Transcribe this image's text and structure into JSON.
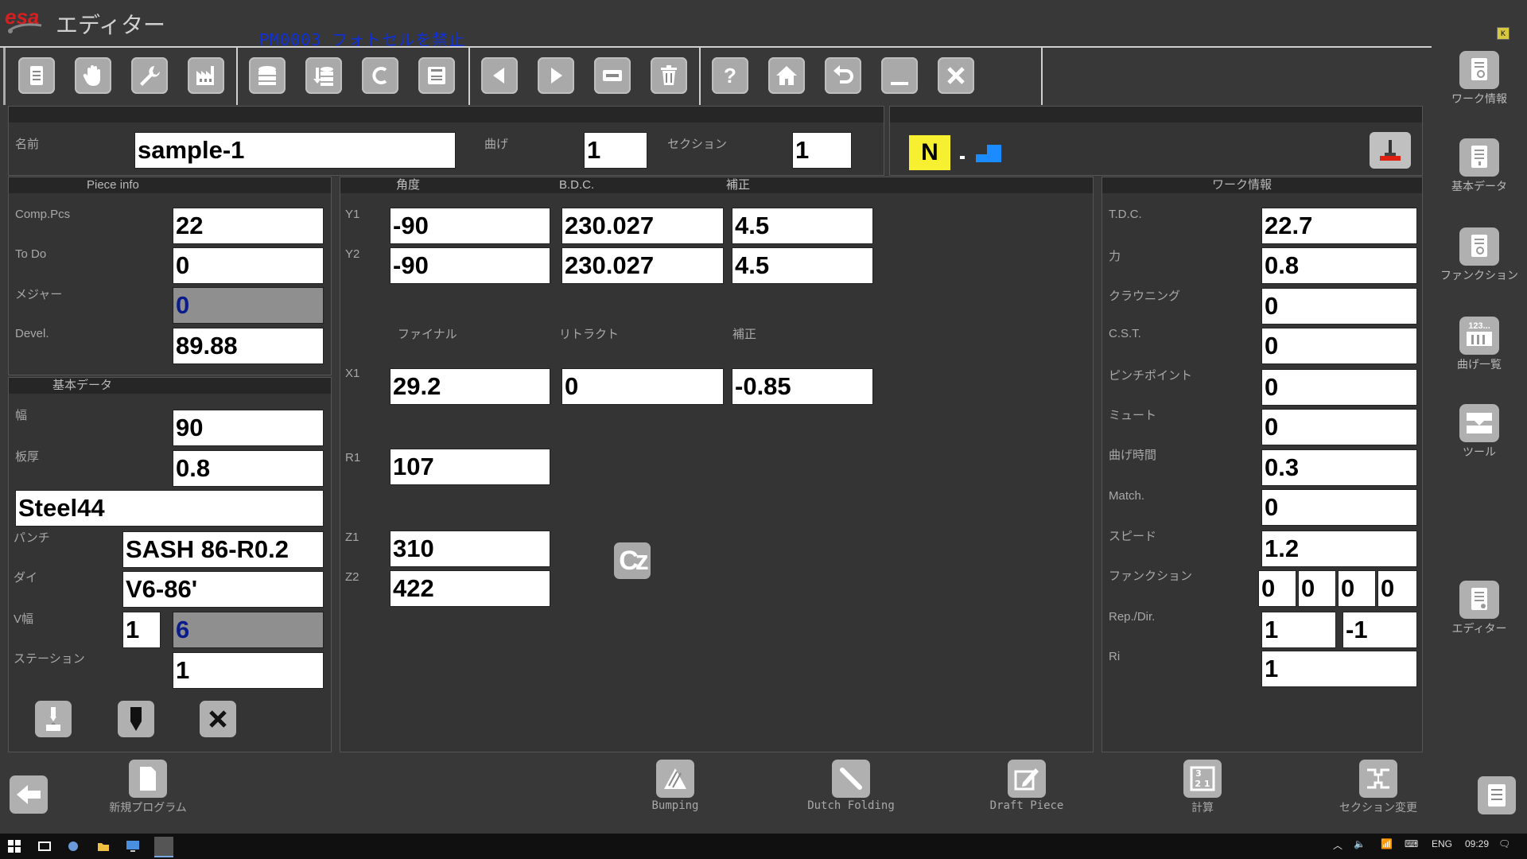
{
  "app": {
    "logo_text": "esa",
    "title": "エディター",
    "message": "PM0003 フォトセルを禁止"
  },
  "toolbar": {
    "buttons": [
      {
        "name": "file-icon"
      },
      {
        "name": "hand-icon"
      },
      {
        "name": "wrench-icon"
      },
      {
        "name": "factory-icon"
      },
      {
        "name": "database-icon"
      },
      {
        "name": "database-down-icon"
      },
      {
        "name": "c-icon"
      },
      {
        "name": "save-icon"
      },
      {
        "name": "prev-icon"
      },
      {
        "name": "next-icon"
      },
      {
        "name": "minus-icon"
      },
      {
        "name": "trash-icon"
      },
      {
        "name": "help-icon"
      },
      {
        "name": "home-icon"
      },
      {
        "name": "undo-icon"
      },
      {
        "name": "minimize-icon"
      },
      {
        "name": "close-icon"
      }
    ]
  },
  "header": {
    "name_label": "名前",
    "name_value": "sample-1",
    "bend_label": "曲げ",
    "bend_value": "1",
    "section_label": "セクション",
    "section_value": "1",
    "mode_badge": "N"
  },
  "piece_info": {
    "title": "Piece info",
    "rows": [
      {
        "label": "Comp.Pcs",
        "value": "22"
      },
      {
        "label": "To Do",
        "value": "0"
      },
      {
        "label": "メジャー",
        "value": "0"
      },
      {
        "label": "Devel.",
        "value": "89.88"
      }
    ]
  },
  "basic_data": {
    "title": "基本データ",
    "width_label": "幅",
    "width_value": "90",
    "thickness_label": "板厚",
    "thickness_value": "0.8",
    "material": "Steel44",
    "punch_label": "パンチ",
    "punch_value": "SASH 86-R0.2",
    "die_label": "ダイ",
    "die_value": "V6-86'",
    "v_label": "V幅",
    "v_value1": "1",
    "v_value2": "6",
    "station_label": "ステーション",
    "station_value": "1"
  },
  "center": {
    "headers": [
      "角度",
      "B.D.C.",
      "補正"
    ],
    "y1": {
      "label": "Y1",
      "values": [
        "-90",
        "230.027",
        "4.5"
      ]
    },
    "y2": {
      "label": "Y2",
      "values": [
        "-90",
        "230.027",
        "4.5"
      ]
    },
    "x_headers": [
      "ファイナル",
      "リトラクト",
      "補正"
    ],
    "x1": {
      "label": "X1",
      "values": [
        "29.2",
        "0",
        "-0.85"
      ]
    },
    "r1": {
      "label": "R1",
      "value": "107"
    },
    "z1": {
      "label": "Z1",
      "value": "310"
    },
    "z2": {
      "label": "Z2",
      "value": "422"
    },
    "cz_label": "Cz"
  },
  "work_info": {
    "title": "ワーク情報",
    "rows": [
      {
        "label": "T.D.C.",
        "value": "22.7"
      },
      {
        "label": "力",
        "value": "0.8"
      },
      {
        "label": "クラウニング",
        "value": "0"
      },
      {
        "label": "C.S.T.",
        "value": "0"
      },
      {
        "label": "ピンチポイント",
        "value": "0"
      },
      {
        "label": "ミュート",
        "value": "0"
      },
      {
        "label": "曲げ時間",
        "value": "0.3"
      },
      {
        "label": "Match.",
        "value": "0"
      },
      {
        "label": "スピード",
        "value": "1.2"
      }
    ],
    "function_label": "ファンクション",
    "function_values": [
      "0",
      "0",
      "0",
      "0"
    ],
    "repdir_label": "Rep./Dir.",
    "repdir_values": [
      "1",
      "-1"
    ],
    "ri_label": "Ri",
    "ri_value": "1"
  },
  "side_nav": [
    {
      "label": "ワーク情報"
    },
    {
      "label": "基本データ"
    },
    {
      "label": "ファンクション"
    },
    {
      "label": "曲げ一覧"
    },
    {
      "label": "ツール"
    },
    {
      "label": "エディター"
    }
  ],
  "side_icon_text": "123...",
  "bottom": {
    "new_program": "新規プログラム",
    "bumping": "Bumping",
    "dutch_folding": "Dutch Folding",
    "draft_piece": "Draft Piece",
    "calc": "計算",
    "section_change": "セクション変更"
  },
  "taskbar": {
    "lang": "ENG",
    "time": "09:29"
  }
}
